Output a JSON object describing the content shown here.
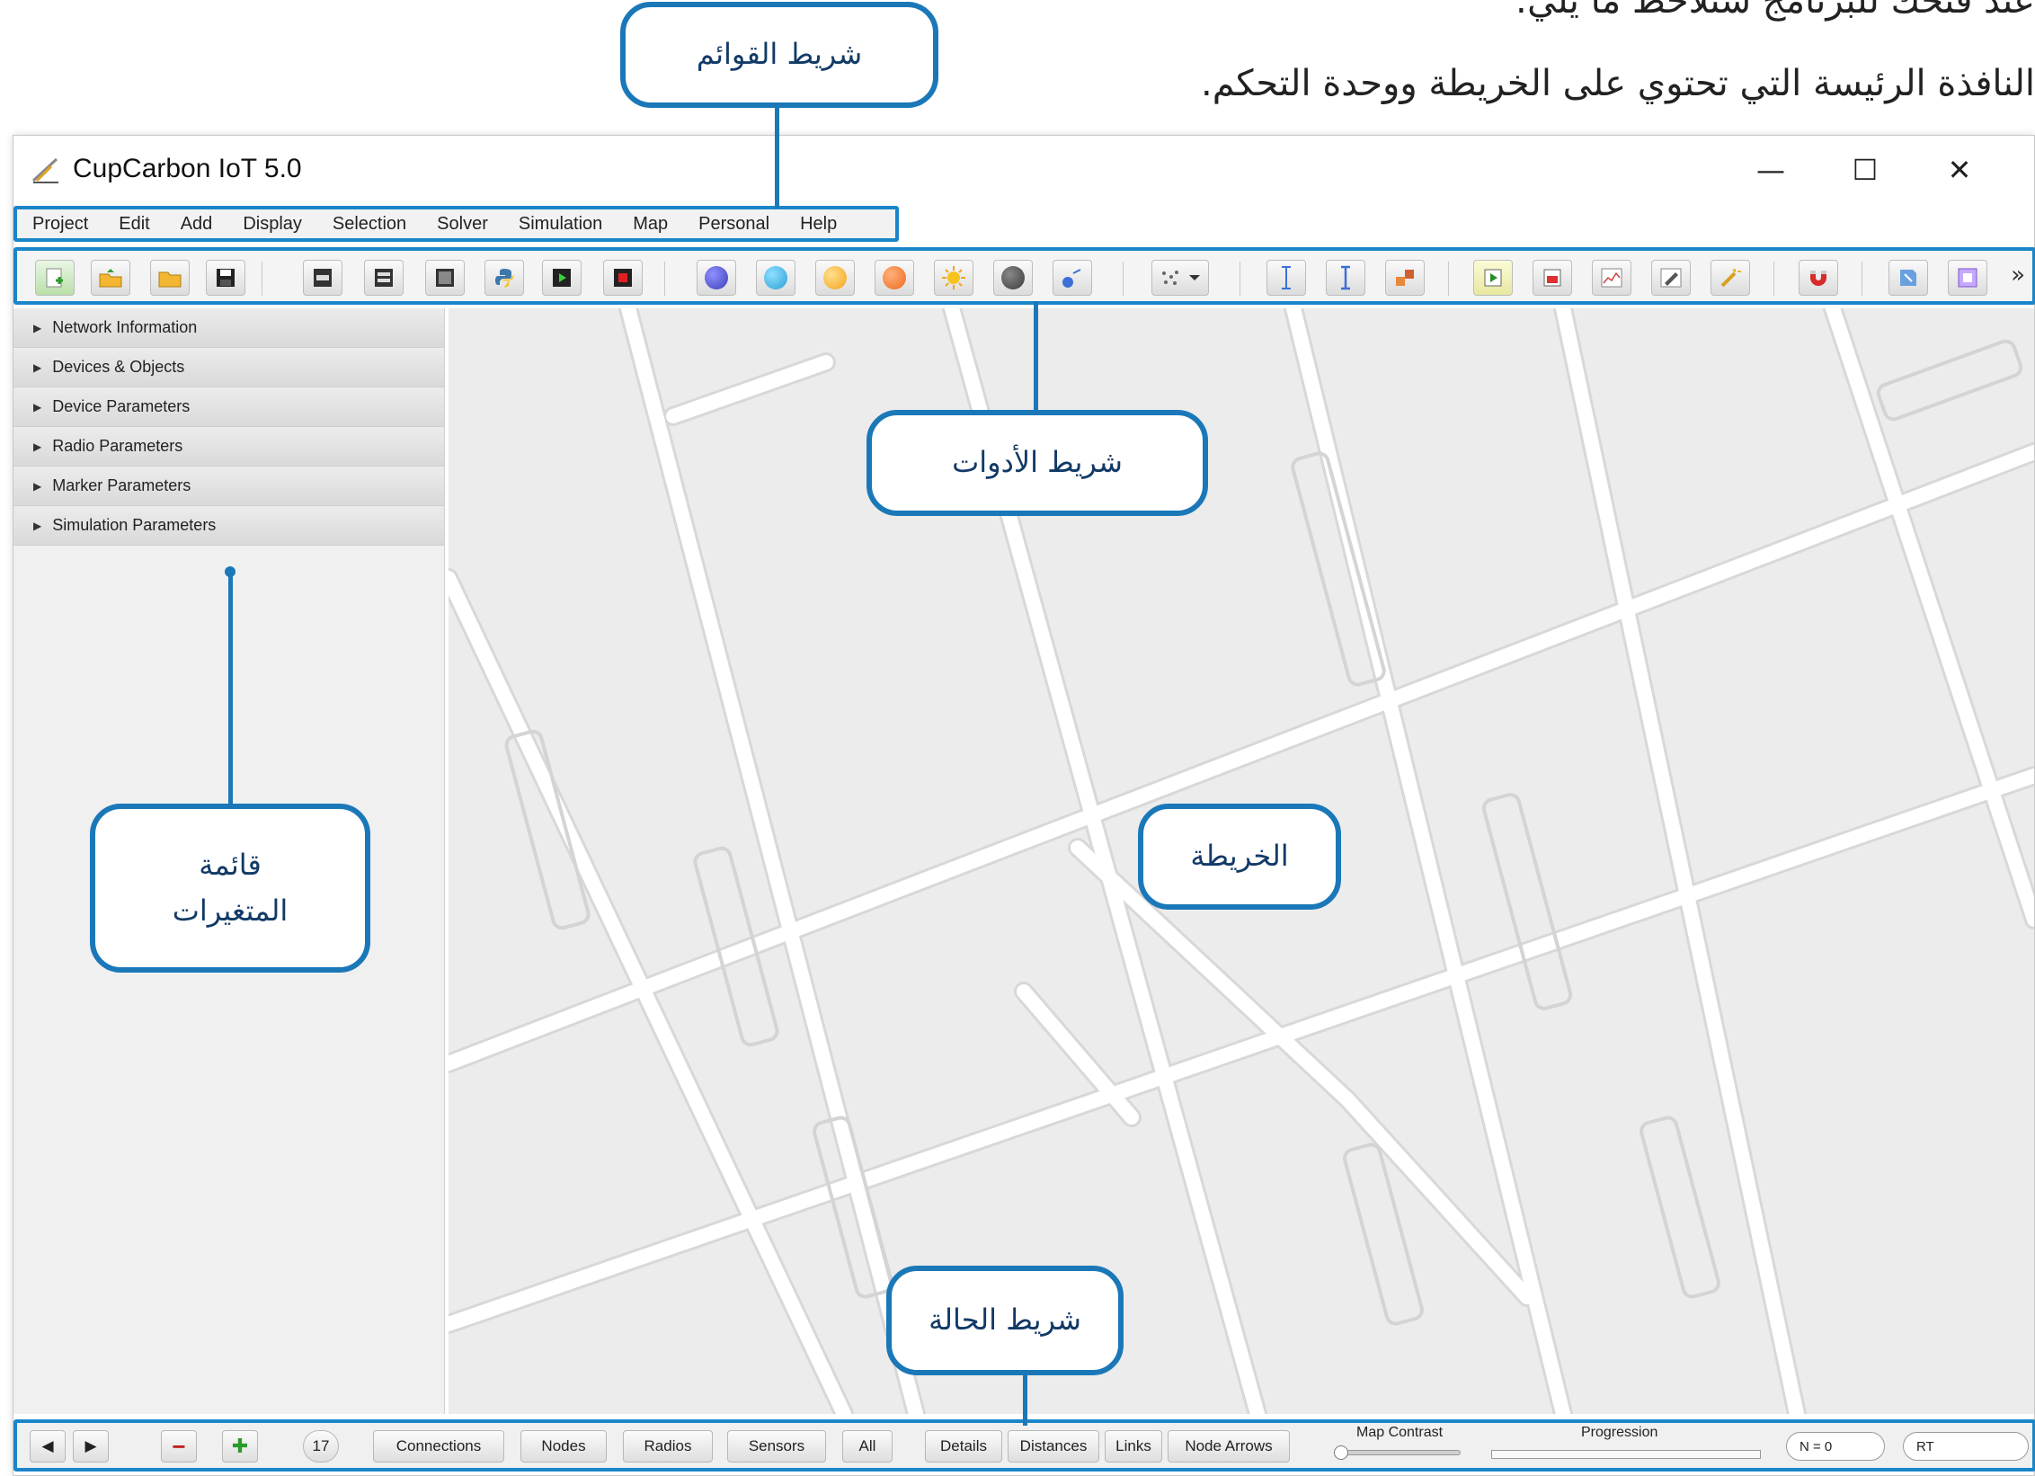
{
  "captions": {
    "line1": "عند فتحك للبرنامج ستلاحظ ما يلي:",
    "line2": "النافذة الرئيسة التي تحتوي على الخريطة ووحدة التحكم."
  },
  "window": {
    "title": "CupCarbon IoT 5.0",
    "controls": {
      "minimize": "—",
      "maximize": "☐",
      "close": "✕"
    }
  },
  "menubar": {
    "items": [
      "Project",
      "Edit",
      "Add",
      "Display",
      "Selection",
      "Solver",
      "Simulation",
      "Map",
      "Personal",
      "Help"
    ]
  },
  "toolbar": {
    "more": "»",
    "ball_colors": [
      "#3e3fb8",
      "#2b9fd6",
      "#f4a318",
      "#ec6a1e",
      "#f6c21e",
      "#3b3b3b"
    ]
  },
  "left_panel": {
    "sections": [
      "Network Information",
      "Devices & Objects",
      "Device Parameters",
      "Radio Parameters",
      "Marker Parameters",
      "Simulation Parameters"
    ]
  },
  "statusbar": {
    "prev": "◀",
    "next": "▶",
    "remove": "−",
    "add": "✚",
    "count": "17",
    "filter_buttons": [
      "Connections",
      "Nodes",
      "Radios",
      "Sensors",
      "All"
    ],
    "view_buttons": [
      "Details",
      "Distances",
      "Links",
      "Node Arrows"
    ],
    "map_contrast_label": "Map Contrast",
    "progression_label": "Progression",
    "n_field": "N = 0",
    "rt_field": "RT"
  },
  "callouts": {
    "menubar": "شريط القوائم",
    "toolbar": "شريط الأدوات",
    "map": "الخريطة",
    "variables_line1": "قائمة",
    "variables_line2": "المتغيرات",
    "statusbar": "شريط الحالة"
  },
  "colors": {
    "accent": "#1a86c9",
    "callout_border": "#1b78b8",
    "map_background": "#ececec",
    "road": "#ffffff"
  }
}
